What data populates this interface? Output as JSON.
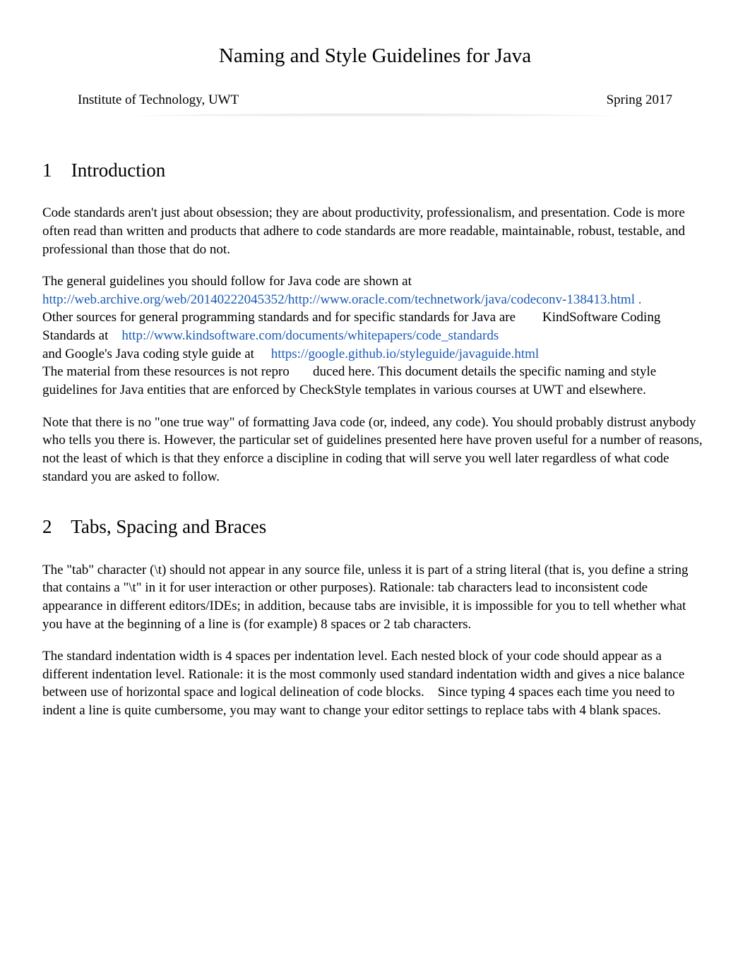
{
  "title": "Naming and Style Guidelines for Java",
  "header": {
    "institute": "Institute of Technology, UWT",
    "term": "Spring 2017"
  },
  "section1": {
    "num": "1",
    "title": "Introduction",
    "p1": "Code standards aren't just about obsession; they are about productivity, professionalism, and presentation. Code is more often read than written and products that adhere to code standards are more readable, maintainable, robust, testable, and professional than those that do not.",
    "p2_intro": "The general guidelines you should follow for Java code are shown at",
    "link1": "http://web.archive.org/web/20140222045352/http://www.oracle.com/technetwork/java/codeconv-138413.html .",
    "p2_mid1": "Other sources for general programming standards and for specific standards for Java are",
    "p2_mid1b": "KindSoftware Coding Standards at",
    "link2": "http://www.kindsoftware.com/documents/whitepapers/code_standards",
    "p2_mid2": "and Google's Java coding style guide at",
    "link3": "https://google.github.io/styleguide/javaguide.html",
    "p2_end": "The material from these resources is not repro",
    "p2_end2": "duced here. This document details the specific naming and style guidelines for Java entities that are enforced by CheckStyle templates in various courses at UWT and elsewhere.",
    "p3": "Note that there is no \"one true way\" of formatting Java code (or, indeed, any code). You should probably distrust anybody who tells you there is. However, the particular set of guidelines presented here have proven useful for a number of reasons, not the least of which is that they enforce a discipline in coding that will serve you well later regardless of what code standard you are asked to follow."
  },
  "section2": {
    "num": "2",
    "title": "Tabs, Spacing and Braces",
    "p1": "The \"tab\" character (\\t) should not appear in any source file, unless it is part of a string literal (that is, you define a string that contains a \"\\t\" in it for user interaction or other purposes). Rationale: tab characters lead to inconsistent code appearance in different editors/IDEs; in addition, because tabs are invisible, it is impossible for you to tell whether what you have at the beginning of a line is (for example) 8 spaces or 2 tab characters.",
    "p2a": "The standard indentation width is 4 spaces per indentation level. Each nested block of your code should appear as a different indentation level. Rationale: it is the most commonly used standard indentation width and gives a nice balance between use of horizontal space and logical delineation of code blocks.",
    "p2b": "Since typing 4 spaces each time you need to indent a line is quite cumbersome, you may want to change your editor settings to replace tabs with 4 blank spaces."
  }
}
